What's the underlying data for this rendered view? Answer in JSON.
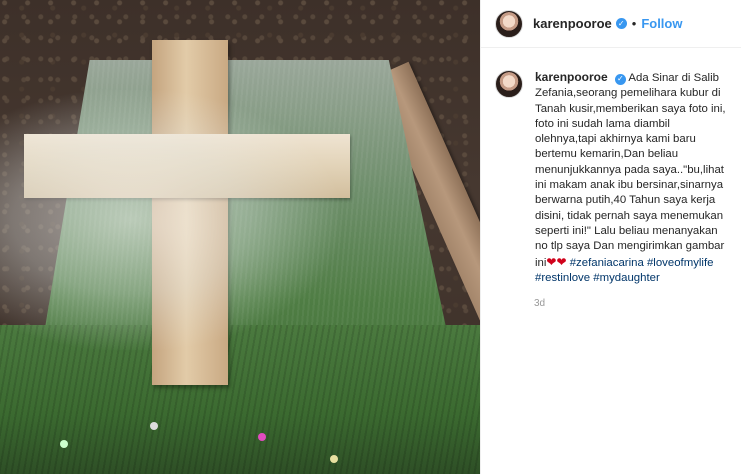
{
  "header": {
    "username": "karenpooroe",
    "separator": "•",
    "follow_label": "Follow",
    "verified_icon": "verified-badge-icon"
  },
  "comment": {
    "username": "karenpooroe",
    "lines": [
      "Ada Sinar di Salib",
      "Zefania,seorang pemelihara kubur di",
      "Tanah kusir,memberikan saya foto ini,",
      "foto ini sudah lama diambil",
      "olehnya,tapi akhirnya kami baru",
      "bertemu kemarin,Dan beliau",
      "menunjukkannya pada saya..\"bu,lihat",
      "ini makam anak ibu bersinar,sinarnya",
      "berwarna putih,40 Tahun saya kerja",
      "disini, tidak pernah saya menemukan",
      "seperti ini!\" Lalu beliau menanyakan",
      "no tlp saya Dan mengirimkan gambar"
    ],
    "last_line_prefix": "ini",
    "hashtags": [
      "#zefaniacarina",
      "#loveofmylife",
      "#restinlove",
      "#mydaughter"
    ],
    "time": "3d"
  },
  "colors": {
    "accent": "#3897f0",
    "hashtag": "#003569",
    "heart": "#d0021b"
  }
}
